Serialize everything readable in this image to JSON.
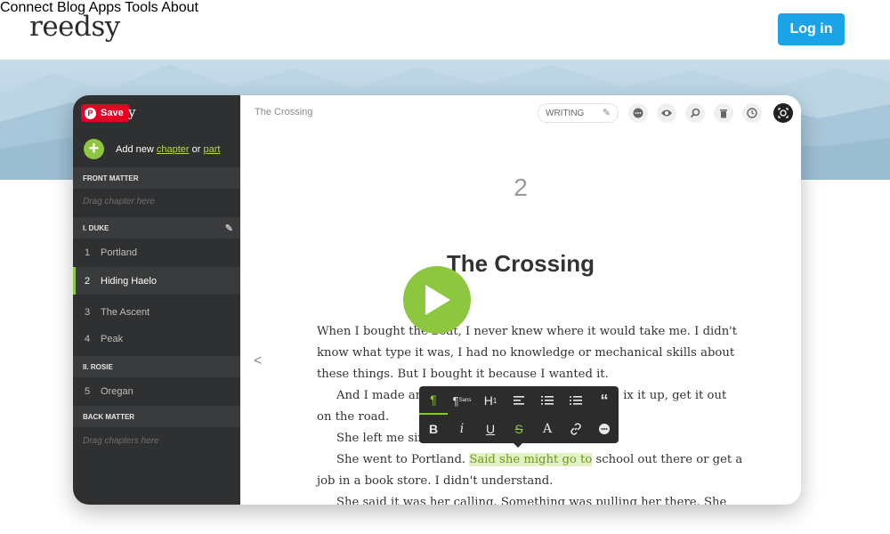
{
  "header": {
    "logo": "reedsy",
    "nav": [
      "Connect",
      "Blog",
      "Apps",
      "Tools",
      "About"
    ],
    "login_label": "Log in"
  },
  "app": {
    "sidebar": {
      "pinterest_save": "Save",
      "logo_fragment": "y",
      "add_prefix": "Add new ",
      "add_chapter": "chapter",
      "add_or": " or ",
      "add_part": "part",
      "sections": [
        {
          "title": "FRONT MATTER",
          "drag": "Drag chapter here"
        },
        {
          "title": "I. DUKE"
        },
        {
          "title": "II. ROSIE"
        },
        {
          "title": "BACK MATTER",
          "drag": "Drag chapters here"
        }
      ],
      "items": [
        {
          "num": "1",
          "label": "Portland"
        },
        {
          "num": "2",
          "label": "Hiding Haelo"
        },
        {
          "num": "3",
          "label": "The Ascent"
        },
        {
          "num": "4",
          "label": "Peak"
        },
        {
          "num": "5",
          "label": "Oregan"
        }
      ]
    },
    "editor": {
      "doc_title": "The Crossing",
      "mode": "WRITING",
      "chapter_number": "2",
      "chapter_title": "The Crossing",
      "paragraphs": {
        "p1a": "When I bought the ",
        "p1b": "boat, I never knew where it would take me. I didn't",
        "p1c": "know what type it was, I had no knowledge or mechanical skills about",
        "p1d": "these things. But I bought it because I wanted it.",
        "p2a": "And I made an",
        "p2b": "ix it up, get it out",
        "p2c": "on the road.",
        "p3": "She left me six",
        "p4a": "She went to Portland. ",
        "p4hl": "Said she might go to",
        "p4b": " school out there or get a",
        "p4c": "job in a book store. I didn't understand.",
        "p5": "She said it was her calling. Something was pulling her there. She"
      },
      "format_toolbar": {
        "row1": [
          "¶",
          "¶Sans",
          "H1",
          "align-left",
          "ordered-list",
          "bullet-list",
          "quote"
        ],
        "row2": [
          "B",
          "i",
          "U",
          "S",
          "A",
          "link",
          "comment"
        ]
      }
    }
  },
  "colors": {
    "accent_green": "#8dc63f",
    "login_blue": "#1aa3e8",
    "sidebar_bg": "#2f3031",
    "pinterest_red": "#e60023"
  }
}
